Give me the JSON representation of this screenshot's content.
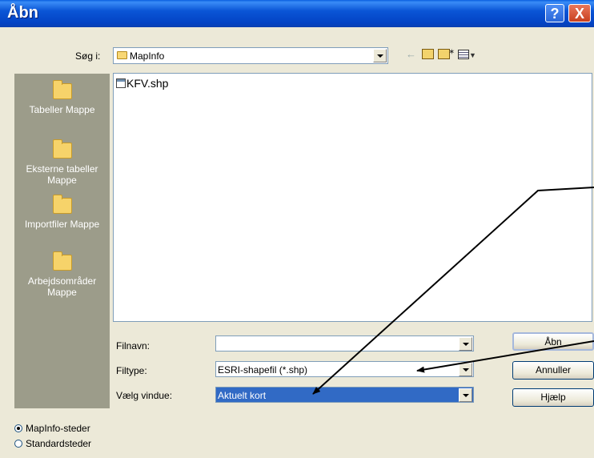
{
  "window": {
    "title": "Åbn",
    "help_glyph": "?",
    "close_glyph": "X"
  },
  "lookin": {
    "label": "Søg i:",
    "value": "MapInfo"
  },
  "toolbar": {
    "icons": [
      "back-arrow-icon",
      "up-folder-icon",
      "new-folder-icon",
      "view-menu-icon"
    ]
  },
  "places": [
    {
      "label": "Tabeller Mappe"
    },
    {
      "label": "Eksterne tabeller Mappe"
    },
    {
      "label": "Importfiler Mappe"
    },
    {
      "label": "Arbejdsområder Mappe"
    }
  ],
  "files": [
    {
      "name": "KFV.shp"
    }
  ],
  "fields": {
    "filename_label": "Filnavn:",
    "filename_value": "",
    "filetype_label": "Filtype:",
    "filetype_value": "ESRI-shapefil (*.shp)",
    "window_label": "Vælg vindue:",
    "window_value": "Aktuelt kort"
  },
  "buttons": {
    "open": "Åbn",
    "cancel": "Annuller",
    "help": "Hjælp"
  },
  "radios": [
    {
      "label": "MapInfo-steder",
      "checked": true
    },
    {
      "label": "Standardsteder",
      "checked": false
    }
  ],
  "colors": {
    "titlebar": "#0a55d6",
    "selection": "#316ac5",
    "places_bg": "#9c9c8a",
    "dialog_bg": "#ece9d8"
  }
}
